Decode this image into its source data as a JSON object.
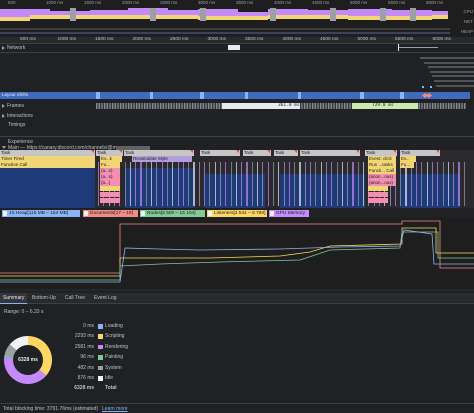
{
  "overview": {
    "ticks": [
      {
        "label": "500",
        "pos": 0
      },
      {
        "label": "1000 ms",
        "pos": 1
      },
      {
        "label": "1500 ms",
        "pos": 2
      },
      {
        "label": "2000 ms",
        "pos": 3
      },
      {
        "label": "2500 ms",
        "pos": 4
      },
      {
        "label": "3000 ms",
        "pos": 5
      },
      {
        "label": "3500 ms",
        "pos": 6
      },
      {
        "label": "4000 ms",
        "pos": 7
      },
      {
        "label": "4500 ms",
        "pos": 8
      },
      {
        "label": "5000 ms",
        "pos": 9
      },
      {
        "label": "5500 ms",
        "pos": 10
      },
      {
        "label": "6000 ms",
        "pos": 11
      }
    ],
    "side_labels": [
      "CPU",
      "NET",
      "HEAP"
    ]
  },
  "ruler": {
    "ticks": [
      "500 ms",
      "1000 ms",
      "1500 ms",
      "2000 ms",
      "2500 ms",
      "3000 ms",
      "3500 ms",
      "4000 ms",
      "4500 ms",
      "5000 ms",
      "5500 ms",
      "6000 ms"
    ]
  },
  "tracks": {
    "network": "Network",
    "frames": "Frames",
    "interactions": "Interactions",
    "timings": "Timings",
    "experience": "Experience",
    "main": "Main — https://canary.discord.com/channels/@me",
    "layout_shifts": "Layout Shifts",
    "frame_times": [
      "361.0 ms",
      "729.0 ms"
    ]
  },
  "flame": {
    "task_label": "Task",
    "rows": [
      [
        {
          "t": "Task",
          "c": "#c6c6c6"
        },
        {
          "t": "Task",
          "c": "#c6c6c6"
        },
        {
          "t": "Task",
          "c": "#c6c6c6"
        },
        {
          "t": "Task",
          "c": "#c6c6c6"
        },
        {
          "t": "Task",
          "c": "#c6c6c6"
        },
        {
          "t": "Task",
          "c": "#c6c6c6"
        },
        {
          "t": "Task",
          "c": "#c6c6c6"
        },
        {
          "t": "Task",
          "c": "#c6c6c6"
        },
        {
          "t": "Task",
          "c": "#c6c6c6"
        }
      ],
      [
        {
          "t": "Timer Fired",
          "c": "#f2d675"
        },
        {
          "t": "Ev...k",
          "c": "#f2d675"
        },
        {
          "t": "Recalculate Style",
          "c": "#b39ddb"
        },
        {
          "t": "Event: click",
          "c": "#f2d675"
        },
        {
          "t": "Ev...",
          "c": "#f2d675"
        }
      ],
      [
        {
          "t": "Function Call",
          "c": "#f2d675"
        },
        {
          "t": "Fu...",
          "c": "#f2d675"
        },
        {
          "t": "Run ...tasks",
          "c": "#f2d675"
        },
        {
          "t": "Fu...",
          "c": "#f2d675"
        }
      ],
      [
        {
          "t": "(a...s)",
          "c": "#f48fb1"
        },
        {
          "t": "Functi... Call",
          "c": "#f2d675"
        }
      ],
      [
        {
          "t": "(a...s)",
          "c": "#f48fb1"
        },
        {
          "t": "(anon...ous)",
          "c": "#f48fb1"
        }
      ],
      [
        {
          "t": "(a...)",
          "c": "#f48fb1"
        },
        {
          "t": "(anon...ous)",
          "c": "#f48fb1"
        }
      ]
    ]
  },
  "legend": {
    "items": [
      {
        "label": "JS Heap[115 MB – 154 MB]",
        "color": "#8ab4f8"
      },
      {
        "label": "Documents[17 – 19]",
        "color": "#f28b82"
      },
      {
        "label": "Nodes[6 500 – 15 104]",
        "color": "#81c995"
      },
      {
        "label": "Listeners[3 531 – 6 780]",
        "color": "#fdd663"
      },
      {
        "label": "GPU Memory",
        "color": "#c58af9"
      }
    ]
  },
  "tabs": [
    "Summary",
    "Bottom-Up",
    "Call Tree",
    "Event Log"
  ],
  "summary": {
    "range": "Range: 0 – 6.33 s",
    "total_center": "6328 ms",
    "rows": [
      {
        "value": "0 ms",
        "label": "Loading",
        "color": "#8ab4f8"
      },
      {
        "value": "2293 ms",
        "label": "Scripting",
        "color": "#fdd663"
      },
      {
        "value": "2581 ms",
        "label": "Rendering",
        "color": "#c58af9"
      },
      {
        "value": "96 ms",
        "label": "Painting",
        "color": "#81c995"
      },
      {
        "value": "482 ms",
        "label": "System",
        "color": "#9aa0a6"
      },
      {
        "value": "876 ms",
        "label": "Idle",
        "color": "#f1f3f4"
      },
      {
        "value": "6328 ms",
        "label": "Total",
        "color": ""
      }
    ],
    "donut": [
      0,
      2293,
      2581,
      96,
      482,
      876
    ]
  },
  "status": {
    "text": "Total blocking time: 3791.76ms (estimated)",
    "link": "Learn more"
  }
}
